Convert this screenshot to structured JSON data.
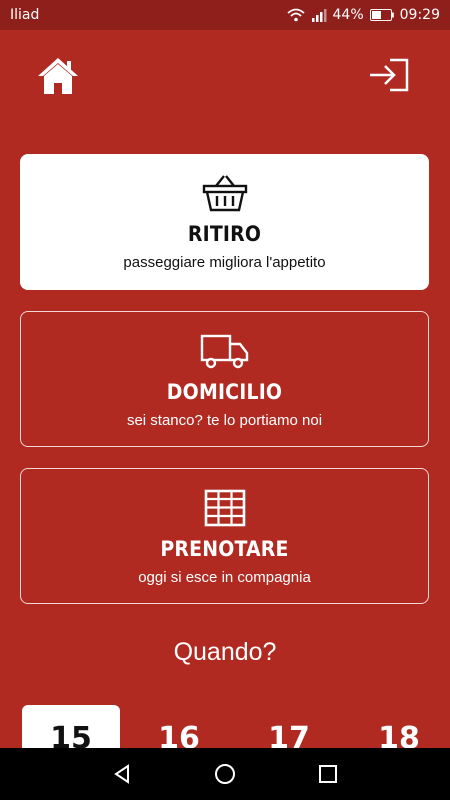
{
  "status_bar": {
    "carrier": "Iliad",
    "battery": "44%",
    "time": "09:29"
  },
  "header": {
    "home_icon": "home-icon",
    "login_icon": "login-icon"
  },
  "options": [
    {
      "title": "RITIRO",
      "subtitle": "passeggiare migliora l'appetito",
      "icon": "basket-icon"
    },
    {
      "title": "DOMICILIO",
      "subtitle": "sei stanco? te lo portiamo noi",
      "icon": "truck-icon"
    },
    {
      "title": "PRENOTARE",
      "subtitle": "oggi si esce in compagnia",
      "icon": "table-icon"
    }
  ],
  "when_label": "Quando?",
  "dates": [
    "15",
    "16",
    "17",
    "18"
  ],
  "colors": {
    "background": "#b02a22",
    "card_active": "#ffffff",
    "status_bar": "#8f1f1a"
  }
}
